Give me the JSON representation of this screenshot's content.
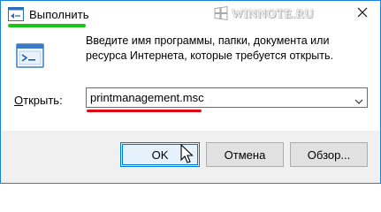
{
  "window": {
    "title": "Выполнить",
    "watermark": "WINNOTE.RU",
    "close_icon": "close-icon"
  },
  "content": {
    "description": "Введите имя программы, папки, документа или ресурса Интернета, которые требуется открыть.",
    "open_label_underlined": "О",
    "open_label_rest": "ткрыть:",
    "command_value": "printmanagement.msc",
    "run_icon": "run-dialog-icon"
  },
  "buttons": {
    "ok": "OK",
    "cancel": "Отмена",
    "browse": "Обзор..."
  },
  "colors": {
    "accent": "#0078d7",
    "highlight_green": "#17c418",
    "highlight_red": "#e00814",
    "footer_bg": "#f0f0f0"
  }
}
